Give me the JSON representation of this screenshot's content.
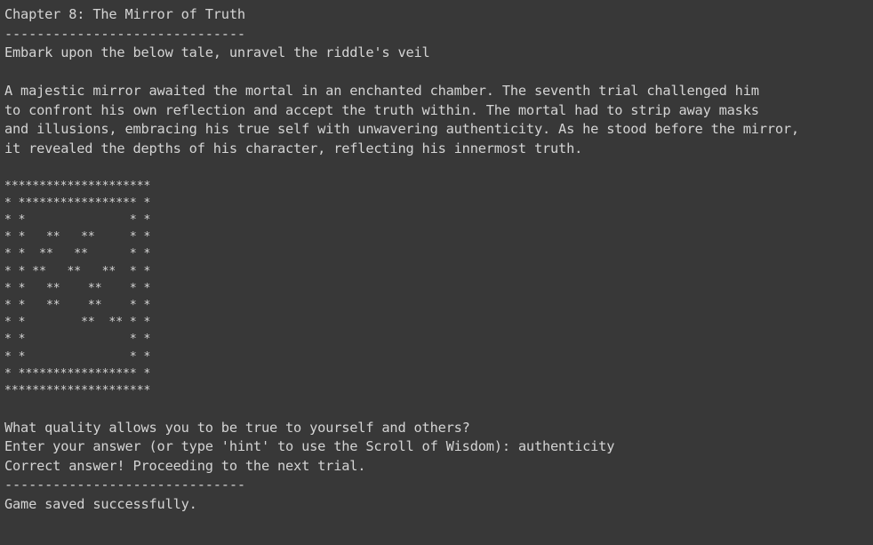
{
  "chapter_title": "Chapter 8: The Mirror of Truth",
  "separator_short": "------------------------------",
  "prompt_intro": "Embark upon the below tale, unravel the riddle's veil",
  "story": [
    "A majestic mirror awaited the mortal in an enchanted chamber. The seventh trial challenged him",
    "to confront his own reflection and accept the truth within. The mortal had to strip away masks",
    "and illusions, embracing his true self with unwavering authenticity. As he stood before the mirror,",
    "it revealed the depths of his character, reflecting his innermost truth."
  ],
  "ascii_art": [
    "*********************",
    "* ***************** *",
    "* *               * *",
    "* *   **   **     * *",
    "* *  **   **      * *",
    "* * **   **   **  * *",
    "* *   **    **    * *",
    "* *   **    **    * *",
    "* *        **  ** * *",
    "* *               * *",
    "* *               * *",
    "* ***************** *",
    "*********************"
  ],
  "question": "What quality allows you to be true to yourself and others?",
  "answer_prompt": "Enter your answer (or type 'hint' to use the Scroll of Wisdom): authenticity",
  "result": "Correct answer! Proceeding to the next trial.",
  "separator_long": "------------------------------",
  "save_status": "Game saved successfully."
}
